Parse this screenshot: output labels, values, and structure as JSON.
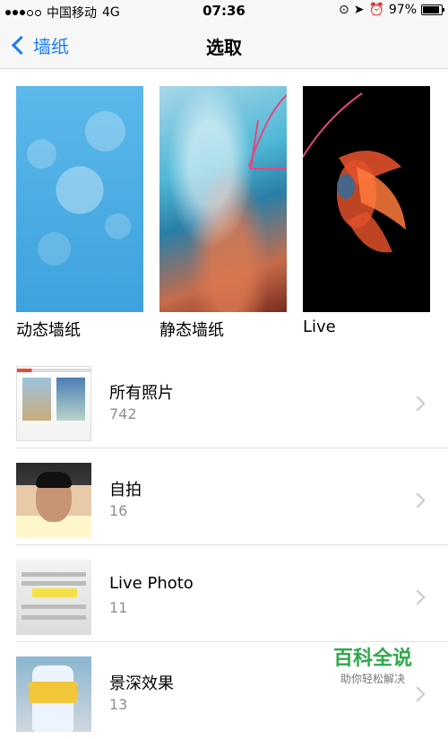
{
  "status_bar": {
    "carrier": "中国移动",
    "network": "4G",
    "time": "07:36",
    "battery": "97%",
    "battery_level": 0.97
  },
  "nav": {
    "back_label": "墙纸",
    "title": "选取"
  },
  "wallpapers": [
    {
      "label": "动态墙纸"
    },
    {
      "label": "静态墙纸"
    },
    {
      "label": "Live"
    }
  ],
  "albums": [
    {
      "title": "所有照片",
      "count": "742"
    },
    {
      "title": "自拍",
      "count": "16"
    },
    {
      "title": "Live Photo",
      "count": "11"
    },
    {
      "title": "景深效果",
      "count": "13"
    }
  ],
  "watermark": {
    "title": "百科全说",
    "subtitle": "助你轻松解决"
  },
  "colors": {
    "accent": "#1a7cf5",
    "watermark": "#2ea84a"
  }
}
